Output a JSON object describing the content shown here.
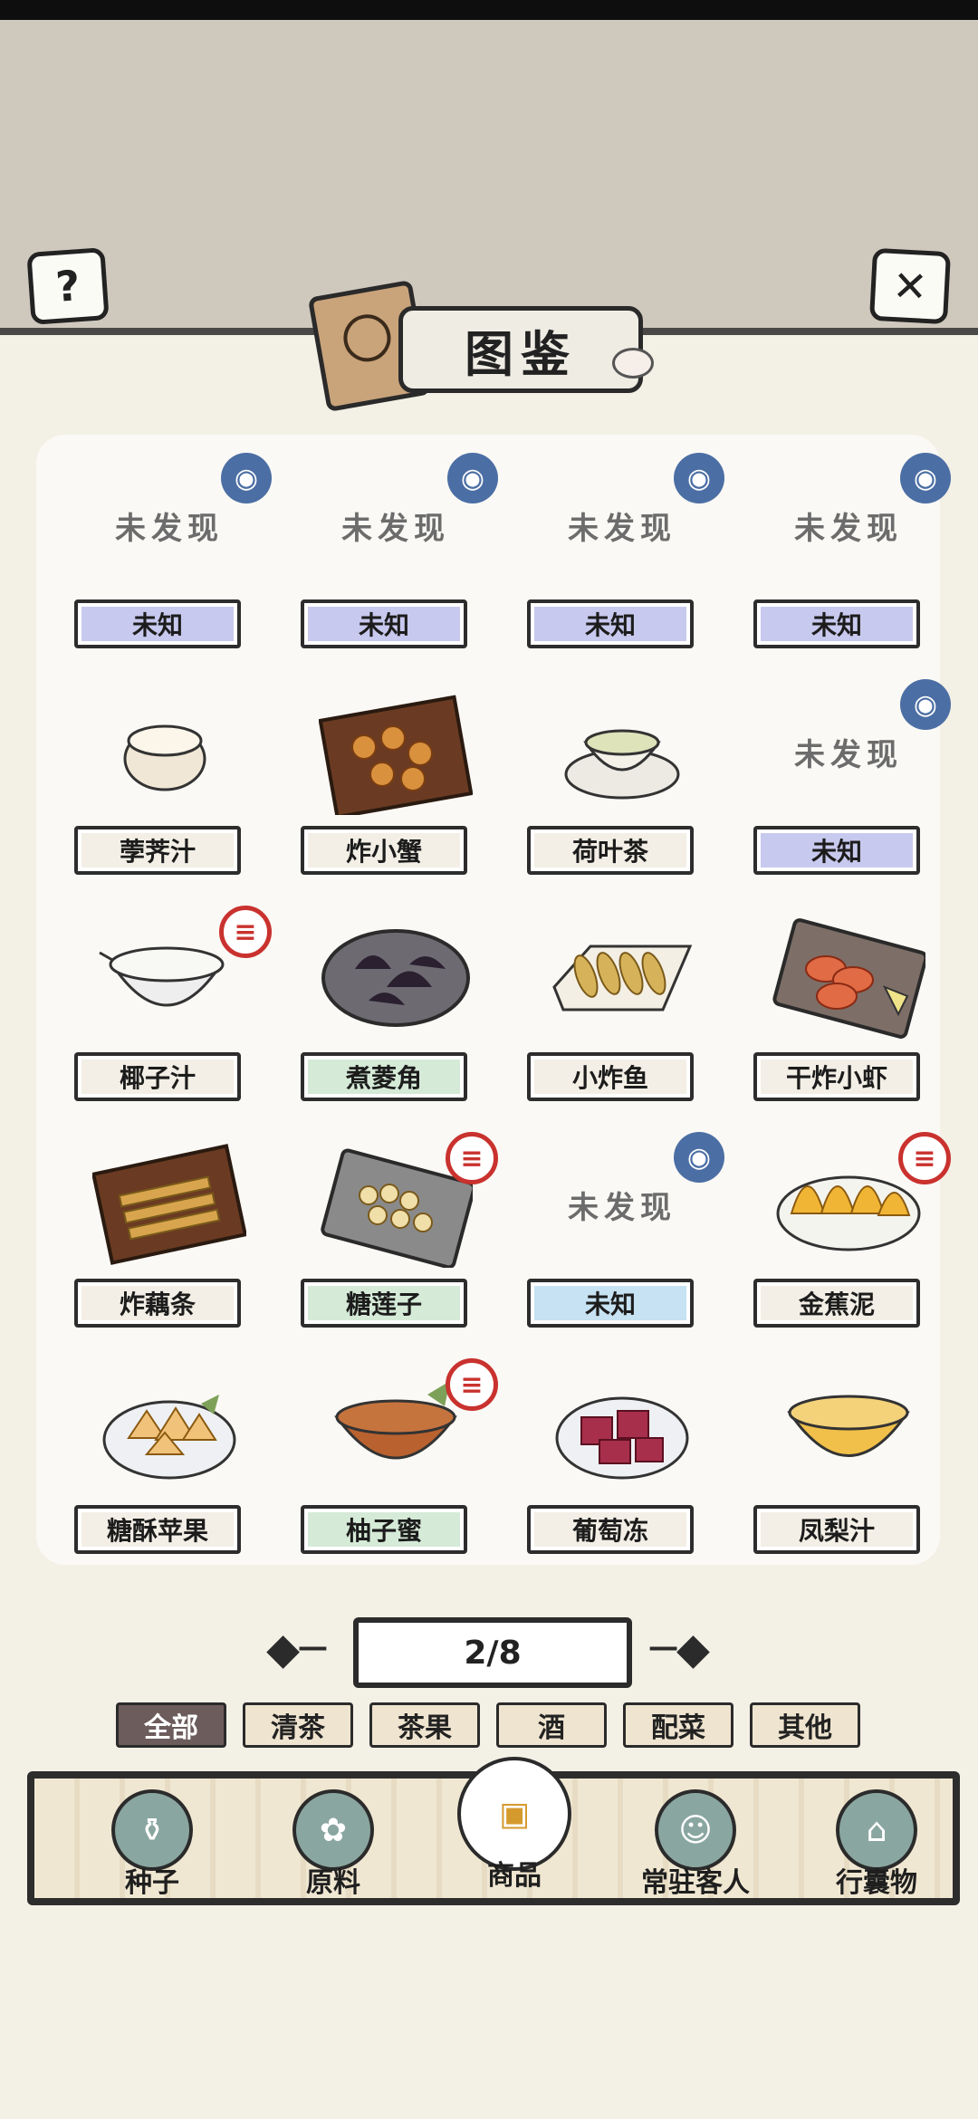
{
  "header": {
    "title": "图鉴",
    "help_icon": "?",
    "close_icon": "✕"
  },
  "grid": {
    "items": [
      {
        "name": "未知",
        "discovered": false,
        "display": "未发现",
        "badge": "blue",
        "label_color": "purple"
      },
      {
        "name": "未知",
        "discovered": false,
        "display": "未发现",
        "badge": "blue",
        "label_color": "purple"
      },
      {
        "name": "未知",
        "discovered": false,
        "display": "未发现",
        "badge": "blue",
        "label_color": "purple"
      },
      {
        "name": "未知",
        "discovered": false,
        "display": "未发现",
        "badge": "blue",
        "label_color": "purple"
      },
      {
        "name": "荸荠汁",
        "discovered": true,
        "badge": "",
        "label_color": "plain",
        "food": "white-cup"
      },
      {
        "name": "炸小蟹",
        "discovered": true,
        "badge": "",
        "label_color": "plain",
        "food": "crab-box"
      },
      {
        "name": "荷叶茶",
        "discovered": true,
        "badge": "",
        "label_color": "plain",
        "food": "tea-cup"
      },
      {
        "name": "未知",
        "discovered": false,
        "display": "未发现",
        "badge": "blue",
        "label_color": "purple"
      },
      {
        "name": "椰子汁",
        "discovered": true,
        "badge": "red",
        "label_color": "plain",
        "food": "milk-bowl"
      },
      {
        "name": "煮菱角",
        "discovered": true,
        "badge": "",
        "label_color": "green",
        "food": "dark-plate"
      },
      {
        "name": "小炸鱼",
        "discovered": true,
        "badge": "",
        "label_color": "plain",
        "food": "fish-plate"
      },
      {
        "name": "干炸小虾",
        "discovered": true,
        "badge": "",
        "label_color": "plain",
        "food": "shrimp-plate"
      },
      {
        "name": "炸藕条",
        "discovered": true,
        "badge": "",
        "label_color": "plain",
        "food": "fries-box"
      },
      {
        "name": "糖莲子",
        "discovered": true,
        "badge": "red",
        "label_color": "green",
        "food": "lotus-plate"
      },
      {
        "name": "未知",
        "discovered": false,
        "display": "未发现",
        "badge": "blue",
        "label_color": "blue"
      },
      {
        "name": "金蕉泥",
        "discovered": true,
        "badge": "red",
        "label_color": "plain",
        "food": "yellow-dumplings"
      },
      {
        "name": "糖酥苹果",
        "discovered": true,
        "badge": "",
        "label_color": "plain",
        "food": "apple-bowl"
      },
      {
        "name": "柚子蜜",
        "discovered": true,
        "badge": "red",
        "label_color": "green",
        "food": "sauce-bowl"
      },
      {
        "name": "葡萄冻",
        "discovered": true,
        "badge": "",
        "label_color": "plain",
        "food": "red-jelly"
      },
      {
        "name": "凤梨汁",
        "discovered": true,
        "badge": "",
        "label_color": "plain",
        "food": "yellow-bowl"
      }
    ]
  },
  "pager": {
    "text": "2/8"
  },
  "filters": [
    {
      "label": "全部",
      "active": true
    },
    {
      "label": "清茶",
      "active": false
    },
    {
      "label": "茶果",
      "active": false
    },
    {
      "label": "酒",
      "active": false
    },
    {
      "label": "配菜",
      "active": false
    },
    {
      "label": "其他",
      "active": false
    }
  ],
  "tabs": [
    {
      "label": "种子",
      "icon": "seed-jar-icon",
      "active": false
    },
    {
      "label": "原料",
      "icon": "leaf-icon",
      "active": false
    },
    {
      "label": "商品",
      "icon": "goods-tray-icon",
      "active": true
    },
    {
      "label": "常驻客人",
      "icon": "girl-icon",
      "active": false
    },
    {
      "label": "行囊物",
      "icon": "bag-icon",
      "active": false
    }
  ]
}
